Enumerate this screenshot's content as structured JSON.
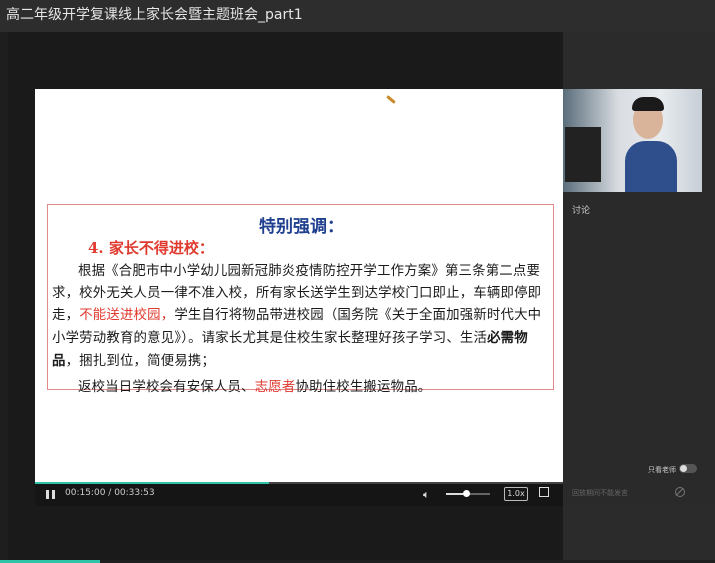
{
  "window": {
    "title": "高二年级开学复课线上家长会暨主题班会_part1"
  },
  "slide": {
    "title": "特别强调：",
    "subtitle": "4. 家长不得进校：",
    "para1_a": "根据《合肥市中小学幼儿园新冠肺炎疫情防控开学工作方案》第三条第二点要求，校外无关人员一律不准入校，所有家长送学生到达学校门口即止，车辆即停即走，",
    "para1_red": "不能送进校园，",
    "para1_b": "学生自行将物品带进校园（国务院《关于全面加强新时代大中小学劳动教育的意见》）。请家长尤其是住校生家长整理好孩子学习、生活",
    "para1_bold": "必需物品",
    "para1_c": "，捆扎到位，简便易携；",
    "para2_a": "返校当日学校会有安保人员、",
    "para2_red": "志愿者",
    "para2_b": "协助住校生搬运物品。"
  },
  "player": {
    "current_time": "00:15:00",
    "separator": " / ",
    "total_time": "00:33:53",
    "progress_fraction": 0.443,
    "volume_fraction": 0.45,
    "speed_label": "1.0x",
    "pause_icon": "pause-icon",
    "volume_icon": "volume-icon",
    "fullscreen_icon": "fullscreen-icon"
  },
  "side_panel": {
    "discussion_label": "讨论",
    "teacher_only_label": "只看老师",
    "comment_placeholder": "回放期间不能发言",
    "ban_icon": "ban-icon"
  },
  "colors": {
    "accent": "#2fc4a8",
    "slide_title": "#1f3f8f",
    "highlight_red": "#e03a2f",
    "box_border": "#e08a8a"
  }
}
